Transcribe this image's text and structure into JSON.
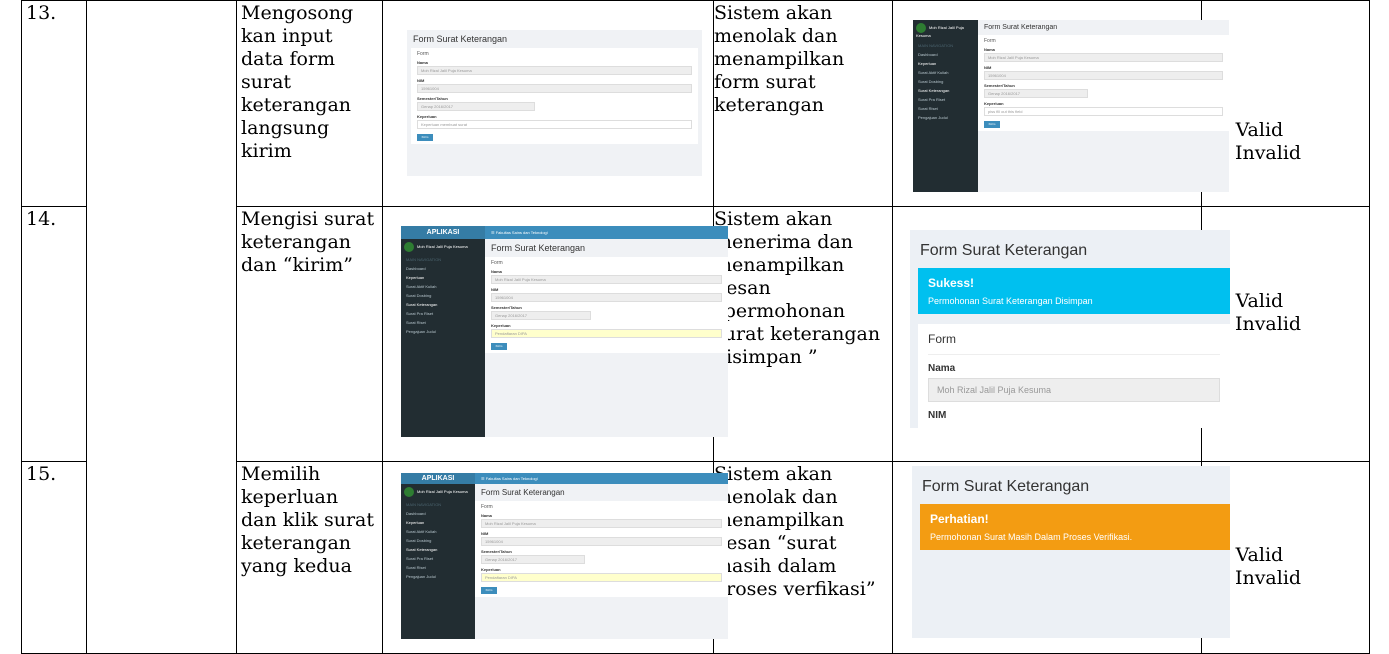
{
  "rows": [
    {
      "no": "13.",
      "scenario": "Mengosong kan input data form surat keterangan langsung kirim",
      "expected": "Sistem akan menolak dan menampilkan form surat keterangan",
      "valid_label": "Valid",
      "invalid_label": "Invalid"
    },
    {
      "no": "14.",
      "scenario": "Mengisi surat keterangan dan “kirim”",
      "expected": "Sistem akan menerima dan menampilkan pesan “permohonan surat keterangan disimpan ”",
      "valid_label": "Valid",
      "invalid_label": "Invalid"
    },
    {
      "no": "15.",
      "scenario": "Memilih keperluan dan klik surat keterangan yang kedua",
      "expected": "Sistem akan menolak dan menampilkan pesan “surat masih dalam proses verfikasi”",
      "valid_label": "Valid",
      "invalid_label": "Invalid"
    }
  ],
  "check_mark": "√",
  "screens": {
    "form_title": "Form Surat Keterangan",
    "form_label": "Form",
    "nama_label": "Nama",
    "nama_value": "Moh Rizal Jalil Puja Kesuma",
    "nim_label": "NIM",
    "nim_value": "15961004",
    "nim_label_zoom": "NIM",
    "semester_label": "Semester/Tahun",
    "semester_value": "Genap 2016/2017",
    "keperluan_label": "Keperluan",
    "keperluan_placeholder": "Keperluan membuat surat",
    "keperluan_value_13b": "piss fill out this field",
    "keperluan_value": "Pendaftaran DIPA",
    "button_label": "Kirim",
    "app_name": "APLIKASI",
    "topbar_text": "☰ Fakultas Sains dan Teknologi",
    "user_name": "Moh Rizal Jalil Puja Kesuma",
    "user_status": "● 15961004",
    "nav_header": "MAIN NAVIGATION",
    "menu": [
      "Dashboard",
      "Keperluan",
      "Surat Aktif Kuliah",
      "Surat Dosbing",
      "Surat Keterangan",
      "Surat Pra Riset",
      "Surat Riset",
      "Pengajuan Judul"
    ],
    "success_title": "Sukess!",
    "success_msg": "Permohonan Surat Keterangan Disimpan",
    "warning_title": "Perhatian!",
    "warning_msg": "Permohonan Surat Masih Dalam Proses Verifikasi.",
    "colors": {
      "success": "#00c0ef",
      "warning": "#f39c12",
      "primary": "#3c8dbc",
      "sidebar": "#222d32"
    }
  }
}
